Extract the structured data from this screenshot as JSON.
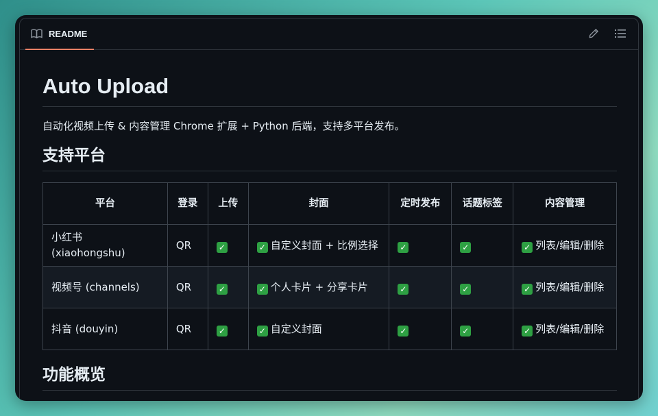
{
  "tab": {
    "label": "README",
    "icon": "book-icon"
  },
  "toolbar": {
    "edit_icon": "pencil-icon",
    "outline_icon": "list-icon"
  },
  "readme": {
    "title": "Auto Upload",
    "description": "自动化视频上传 & 内容管理 Chrome 扩展 + Python 后端，支持多平台发布。",
    "section_platforms": "支持平台",
    "section_features": "功能概览"
  },
  "table": {
    "headers": [
      "平台",
      "登录",
      "上传",
      "封面",
      "定时发布",
      "话题标签",
      "内容管理"
    ],
    "rows": [
      {
        "platform": "小红书 (xiaohongshu)",
        "login": "QR",
        "upload": "",
        "cover": "自定义封面 + 比例选择",
        "schedule": "",
        "tags": "",
        "manage": "列表/编辑/删除"
      },
      {
        "platform": "视频号 (channels)",
        "login": "QR",
        "upload": "",
        "cover": "个人卡片 + 分享卡片",
        "schedule": "",
        "tags": "",
        "manage": "列表/编辑/删除"
      },
      {
        "platform": "抖音 (douyin)",
        "login": "QR",
        "upload": "",
        "cover": "自定义封面",
        "schedule": "",
        "tags": "",
        "manage": "列表/编辑/删除"
      }
    ]
  },
  "colors": {
    "background": "#0d1117",
    "border": "#30363d",
    "accent": "#f78166",
    "check": "#2ea043"
  }
}
